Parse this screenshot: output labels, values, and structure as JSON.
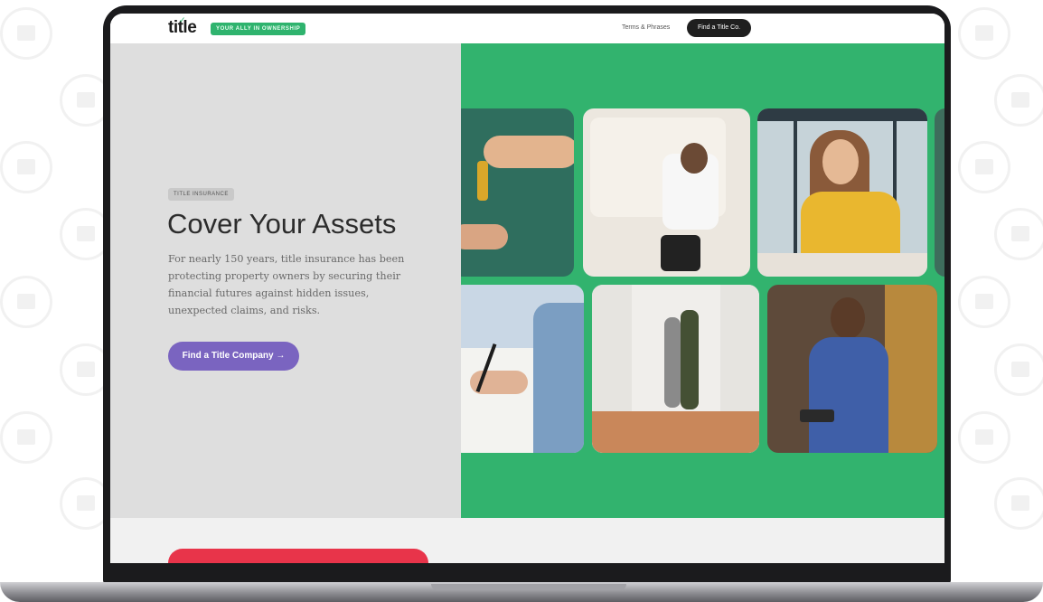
{
  "navbar": {
    "logo": "title",
    "tagline": "YOUR ALLY IN OWNERSHIP",
    "link": "Terms & Phrases",
    "cta": "Find a Title Co."
  },
  "hero": {
    "eyebrow": "TITLE INSURANCE",
    "headline": "Cover Your Assets",
    "lead": "For nearly 150 years, title insurance has been protecting property owners by securing their financial futures against hidden issues, unexpected claims, and risks.",
    "cta": "Find a Title Company →"
  },
  "colors": {
    "brand_green": "#32b36e",
    "cta_purple": "#7a64c0",
    "accent_red": "#e8344a",
    "hero_gray": "#dedede"
  }
}
